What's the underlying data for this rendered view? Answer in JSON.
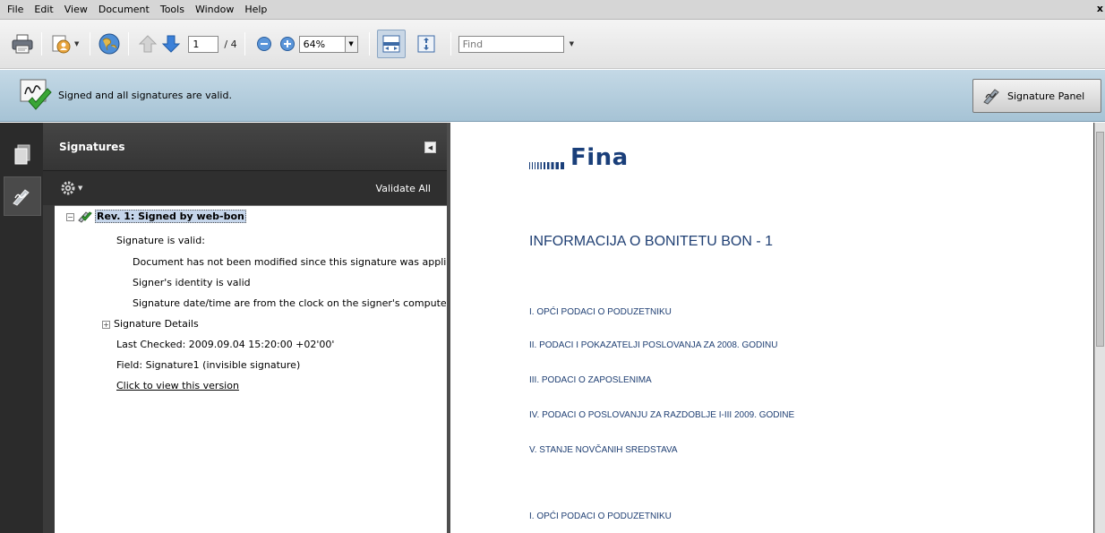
{
  "menu": {
    "items": [
      "File",
      "Edit",
      "View",
      "Document",
      "Tools",
      "Window",
      "Help"
    ],
    "close": "x"
  },
  "toolbar": {
    "current_page": "1",
    "page_count": "/ 4",
    "zoom": "64%",
    "find_placeholder": "Find"
  },
  "message_bar": {
    "text": "Signed and all signatures are valid.",
    "signature_panel_button": "Signature Panel"
  },
  "signatures_panel": {
    "title": "Signatures",
    "validate_all": "Validate All",
    "revision": {
      "label": "Rev. 1: Signed by web-bon",
      "status": "Signature is valid:",
      "details": [
        "Document has not been modified since this signature was applied",
        "Signer's identity is valid",
        "Signature date/time are from the clock on the signer's computer."
      ],
      "signature_details": "Signature Details",
      "last_checked": "Last Checked: 2009.09.04 15:20:00 +02'00'",
      "field": "Field: Signature1 (invisible signature)",
      "view_version_link": "Click to view this version"
    }
  },
  "document": {
    "logo_text": "Fina",
    "title": "INFORMACIJA O BONITETU BON - 1",
    "sections": [
      "I. OPĆI PODACI O PODUZETNIKU",
      "II. PODACI I POKAZATELJI POSLOVANJA ZA 2008. GODINU",
      "III. PODACI O ZAPOSLENIMA",
      "IV. PODACI O POSLOVANJU ZA RAZDOBLJE I-III 2009. GODINE",
      "V. STANJE NOVČANIH SREDSTAVA"
    ],
    "next_heading": "I. OPĆI PODACI O PODUZETNIKU"
  },
  "colors": {
    "message_bar": "#b3cede",
    "panel_dark": "#3a3a3a",
    "doc_text": "#1f3f73",
    "selection": "#c5d5ea"
  }
}
